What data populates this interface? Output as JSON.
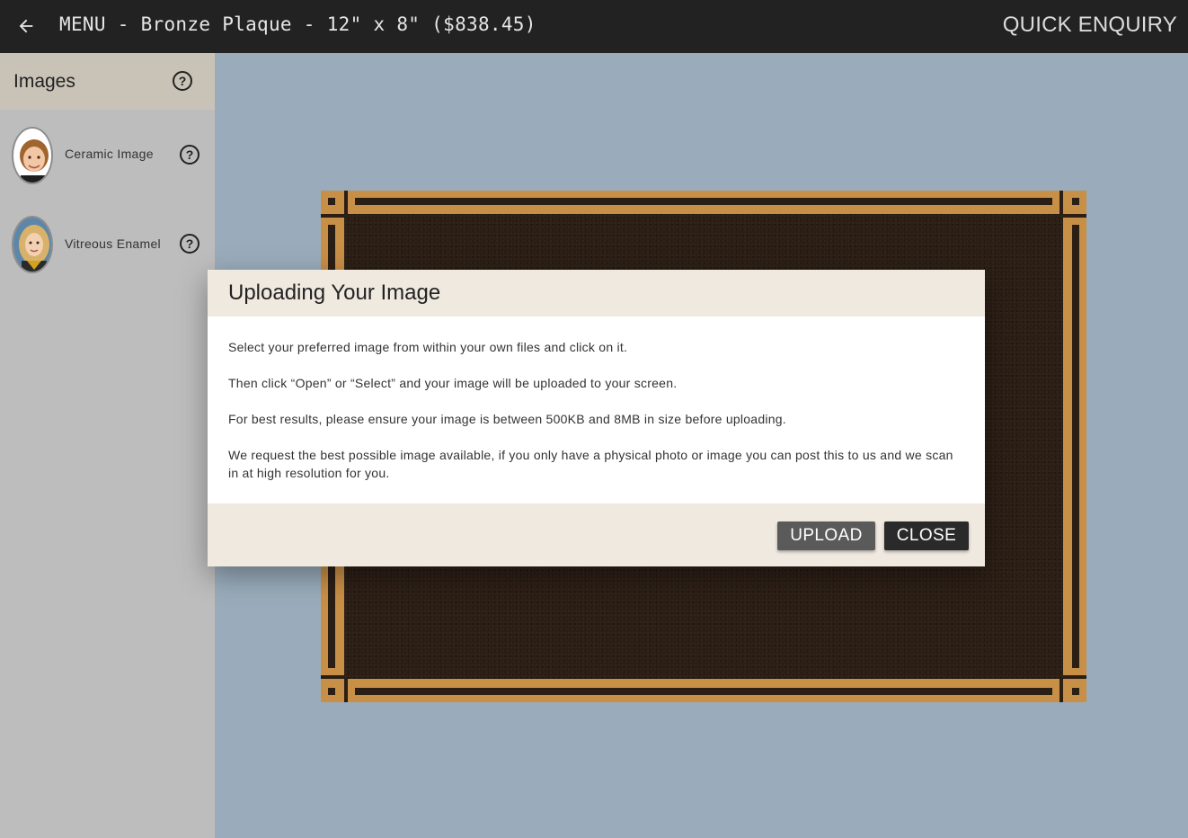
{
  "header": {
    "back_icon": "arrow-left-icon",
    "title": "MENU - Bronze Plaque - 12\" x 8\" ($838.45)",
    "quick_enquiry": "QUICK ENQUIRY"
  },
  "sidebar": {
    "title": "Images",
    "help_symbol": "?",
    "items": [
      {
        "label": "Ceramic Image",
        "help_symbol": "?"
      },
      {
        "label": "Vitreous Enamel",
        "help_symbol": "?"
      }
    ]
  },
  "dialog": {
    "title": "Uploading Your Image",
    "paragraphs": [
      "Select your preferred image from within your own files and click on it.",
      "Then click “Open” or “Select” and your image will be uploaded to your screen.",
      "For best results, please ensure your image is between 500KB and 8MB in size before uploading.",
      "We request the best possible image available, if you only have a physical photo or image you can post this to us and we scan in at high resolution for you."
    ],
    "upload_label": "UPLOAD",
    "close_label": "CLOSE"
  },
  "colors": {
    "topbar": "#222222",
    "sidebar": "#bdbdbd",
    "canvas": "#9aacbb",
    "plaque_border": "#c88f47",
    "plaque_field": "#2b1e15"
  }
}
